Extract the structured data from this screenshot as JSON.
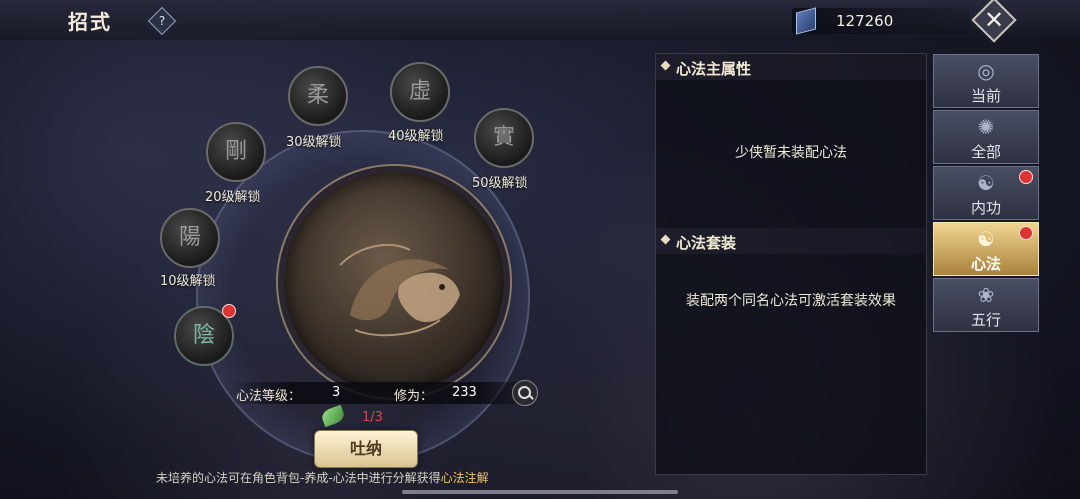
{
  "header": {
    "title": "招式",
    "help_label": "?",
    "currency_icon": "book-icon",
    "currency_value": "127260",
    "close_label": "✕"
  },
  "wheel": {
    "slots": [
      {
        "glyph": "陰",
        "label": "",
        "state": "unlocked",
        "badge": true
      },
      {
        "glyph": "陽",
        "label": "10级解锁",
        "state": "locked",
        "badge": false
      },
      {
        "glyph": "剛",
        "label": "20级解锁",
        "state": "locked",
        "badge": false
      },
      {
        "glyph": "柔",
        "label": "30级解锁",
        "state": "locked",
        "badge": false
      },
      {
        "glyph": "虛",
        "label": "40级解锁",
        "state": "locked",
        "badge": false
      },
      {
        "glyph": "實",
        "label": "50级解锁",
        "state": "locked",
        "badge": false
      }
    ],
    "center_emblem": "koi-fish-emblem"
  },
  "info": {
    "level_label": "心法等级：",
    "level_value": "3",
    "cultivation_label": "修为：",
    "cultivation_value": "233"
  },
  "breathe": {
    "count": "1/3",
    "button_label": "吐纳"
  },
  "hint": {
    "before": "未培养的心法可在角色背包-养成-心法中进行分解获得",
    "highlight": "心法注解"
  },
  "panel": {
    "main_attr_title": "心法主属性",
    "main_attr_text": "少侠暂未装配心法",
    "set_title": "心法套装",
    "set_text": "装配两个同名心法可激活套装效果"
  },
  "tabs": [
    {
      "label": "当前",
      "icon": "current-icon",
      "active": false,
      "badge": false
    },
    {
      "label": "全部",
      "icon": "all-icon",
      "active": false,
      "badge": false
    },
    {
      "label": "内功",
      "icon": "inner-power-icon",
      "active": false,
      "badge": true
    },
    {
      "label": "心法",
      "icon": "heart-method-icon",
      "active": true,
      "badge": true
    },
    {
      "label": "五行",
      "icon": "five-elements-icon",
      "active": false,
      "badge": false
    }
  ],
  "colors": {
    "accent_gold": "#f1c35a",
    "badge_red": "#d33333",
    "count_red": "#e04545"
  }
}
